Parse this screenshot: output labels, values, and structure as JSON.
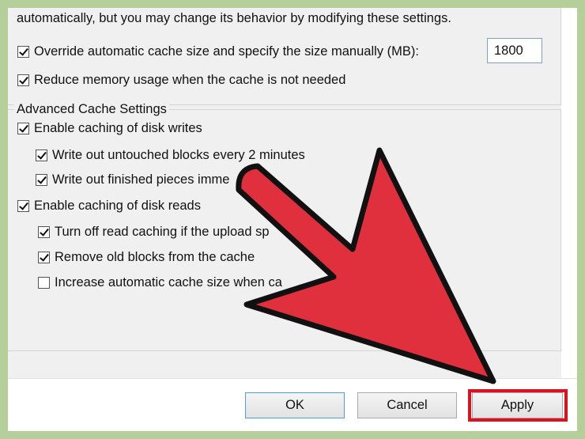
{
  "dialog": {
    "intro_text": "automatically, but you may change its behavior by modifying these settings.",
    "override": {
      "label": "Override automatic cache size and specify the size manually (MB):",
      "checked": true,
      "value": "1800"
    },
    "reduce": {
      "label": "Reduce memory usage when the cache is not needed",
      "checked": true
    },
    "advanced": {
      "legend": "Advanced Cache Settings",
      "items": [
        {
          "label": "Enable caching of disk writes",
          "checked": true
        },
        {
          "label": "Write out untouched blocks every 2 minutes",
          "checked": true
        },
        {
          "label": "Write out finished pieces imme",
          "checked": true
        },
        {
          "label": "Enable caching of disk reads",
          "checked": true
        },
        {
          "label": "Turn off read caching if the upload sp",
          "checked": true
        },
        {
          "label": "Remove old blocks from the cache",
          "checked": true
        },
        {
          "label": "Increase automatic cache size when ca",
          "checked": false
        }
      ]
    }
  },
  "buttons": {
    "ok": "OK",
    "cancel": "Cancel",
    "apply": "Apply"
  },
  "annotation": {
    "arrow_color": "#e0303e",
    "highlight_color": "#e0101e",
    "target": "apply-button"
  }
}
